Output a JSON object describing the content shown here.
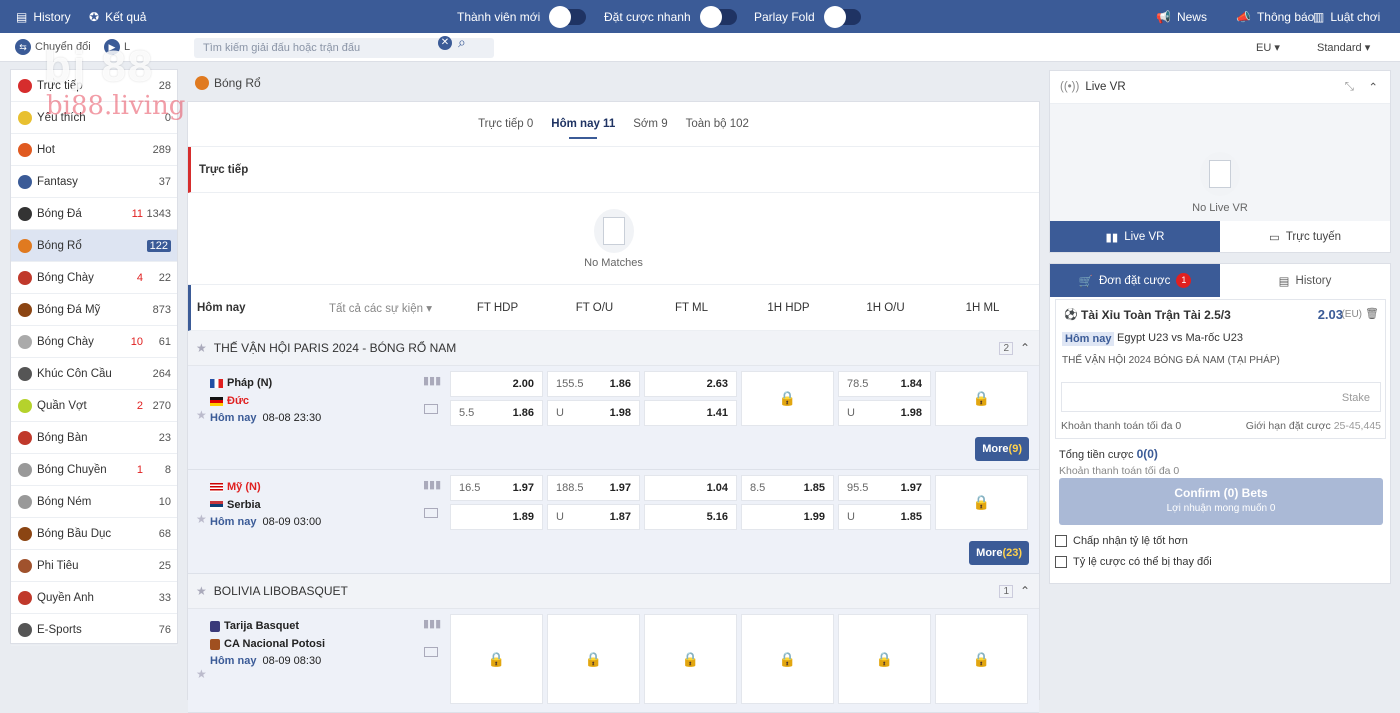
{
  "topbar": {
    "history": "History",
    "results": "Kết quả",
    "new_member": "Thành viên mới",
    "quick_bet": "Đặt cược nhanh",
    "parlay_fold": "Parlay Fold",
    "news": "News",
    "notice": "Thông báo",
    "rules": "Luật chơi"
  },
  "subbar": {
    "switch": "Chuyển đổi",
    "live_short": "L",
    "search_placeholder": "Tìm kiếm giải đấu hoặc trận đấu",
    "odds_format": "EU",
    "view": "Standard"
  },
  "watermark": {
    "logo": "bj 88",
    "site": "bi88.living"
  },
  "sidebar": {
    "items": [
      {
        "label": "Trực tiếp",
        "live": "",
        "count": "28",
        "color": "#d62d2d"
      },
      {
        "label": "Yêu thích",
        "live": "",
        "count": "0",
        "color": "#e8c030"
      },
      {
        "label": "Hot",
        "live": "",
        "count": "289",
        "color": "#e05a20"
      },
      {
        "label": "Fantasy",
        "live": "",
        "count": "37",
        "color": "#3b5b97"
      },
      {
        "label": "Bóng Đá",
        "live": "11",
        "count": "1343",
        "color": "#333333"
      },
      {
        "label": "Bóng Rổ",
        "live": "",
        "count": "122",
        "color": "#e07a20"
      },
      {
        "label": "Bóng Chày",
        "live": "4",
        "count": "22",
        "color": "#c0392b"
      },
      {
        "label": "Bóng Đá Mỹ",
        "live": "",
        "count": "873",
        "color": "#8b4513"
      },
      {
        "label": "Bóng Chày",
        "live": "10",
        "count": "61",
        "color": "#aaaaaa"
      },
      {
        "label": "Khúc Côn Cầu",
        "live": "",
        "count": "264",
        "color": "#555555"
      },
      {
        "label": "Quần Vợt",
        "live": "2",
        "count": "270",
        "color": "#b5d22c"
      },
      {
        "label": "Bóng Bàn",
        "live": "",
        "count": "23",
        "color": "#c0392b"
      },
      {
        "label": "Bóng Chuyền",
        "live": "1",
        "count": "8",
        "color": "#999999"
      },
      {
        "label": "Bóng Ném",
        "live": "",
        "count": "10",
        "color": "#999999"
      },
      {
        "label": "Bóng Bầu Dục",
        "live": "",
        "count": "68",
        "color": "#8b4513"
      },
      {
        "label": "Phi Tiêu",
        "live": "",
        "count": "25",
        "color": "#a0522d"
      },
      {
        "label": "Quyền Anh",
        "live": "",
        "count": "33",
        "color": "#c0392b"
      },
      {
        "label": "E-Sports",
        "live": "",
        "count": "76",
        "color": "#555555"
      }
    ]
  },
  "center": {
    "title": "Bóng Rổ",
    "tabs": [
      "Trực tiếp 0",
      "Hôm nay 11",
      "Sớm 9",
      "Toàn bộ 102"
    ],
    "live_section": "Trực tiếp",
    "no_matches": "No Matches",
    "today": "Hôm nay",
    "all_events": "Tất cả các sự kiện",
    "columns": [
      "FT HDP",
      "FT O/U",
      "FT ML",
      "1H HDP",
      "1H O/U",
      "1H ML"
    ],
    "leagues": [
      {
        "name": "THẾ VẬN HỘI PARIS 2024 - BÓNG RỔ NAM",
        "count": "2",
        "matches": [
          {
            "home": "Pháp (N)",
            "away": "Đức",
            "day": "Hôm nay",
            "time": "08-08 23:30",
            "home_flag": "fr",
            "away_flag": "de",
            "more": "More",
            "more_count": "(9)",
            "rows": [
              [
                [
                  "",
                  "2.00"
                ],
                [
                  "155.5",
                  "1.86"
                ],
                [
                  "",
                  "2.63"
                ]
              ],
              [
                [
                  "5.5",
                  "1.86"
                ],
                [
                  "U",
                  "1.98"
                ],
                [
                  "",
                  "1.41"
                ]
              ]
            ],
            "rows2": [
              [
                [
                  "78.5",
                  "1.84"
                ]
              ],
              [
                [
                  "U",
                  "1.98"
                ]
              ]
            ]
          },
          {
            "home": "Mỹ (N)",
            "away": "Serbia",
            "day": "Hôm nay",
            "time": "08-09 03:00",
            "home_flag": "us",
            "away_flag": "rs",
            "more": "More",
            "more_count": "(23)",
            "rows": [
              [
                [
                  "16.5",
                  "1.97"
                ],
                [
                  "188.5",
                  "1.97"
                ],
                [
                  "",
                  "1.04"
                ],
                [
                  "8.5",
                  "1.85"
                ],
                [
                  "95.5",
                  "1.97"
                ]
              ],
              [
                [
                  "",
                  "1.89"
                ],
                [
                  "U",
                  "1.87"
                ],
                [
                  "",
                  "5.16"
                ],
                [
                  "",
                  "1.99"
                ],
                [
                  "U",
                  "1.85"
                ]
              ]
            ]
          }
        ]
      },
      {
        "name": "BOLIVIA LIBOBASQUET",
        "count": "1",
        "matches": [
          {
            "home": "Tarija Basquet",
            "away": "CA Nacional Potosi",
            "day": "Hôm nay",
            "time": "08-09 08:30"
          }
        ]
      }
    ]
  },
  "livevr": {
    "title": "Live VR",
    "empty": "No Live VR",
    "tab_live": "Live VR",
    "tab_online": "Trực tuyến"
  },
  "betslip": {
    "tab_orders": "Đơn đặt cược",
    "orders_count": "1",
    "tab_history": "History",
    "bet_title": "Tài Xỉu Toàn Trận Tài 2.5/3",
    "bet_odds": "2.03",
    "odds_format": "(EU)",
    "bet_day": "Hôm nay",
    "bet_match": "Egypt U23 vs Ma-rốc U23",
    "bet_league": "THẾ VẬN HỘI 2024 BÓNG ĐÁ NAM (TẠI PHÁP)",
    "stake_placeholder": "Stake",
    "max_payout": "Khoản thanh toán tối đa 0",
    "bet_limit_label": "Giới hạn đặt cược",
    "bet_limit": "25-45,445",
    "total_label": "Tổng tiền cược",
    "total_value": "0(0)",
    "max_payout2": "Khoản thanh toán tối đa 0",
    "confirm": "Confirm (0) Bets",
    "expected": "Lợi nhuận mong muốn 0",
    "accept_better": "Chấp nhận tỷ lệ tốt hơn",
    "odds_change": "Tỷ lệ cược có thể bị thay đổi"
  }
}
